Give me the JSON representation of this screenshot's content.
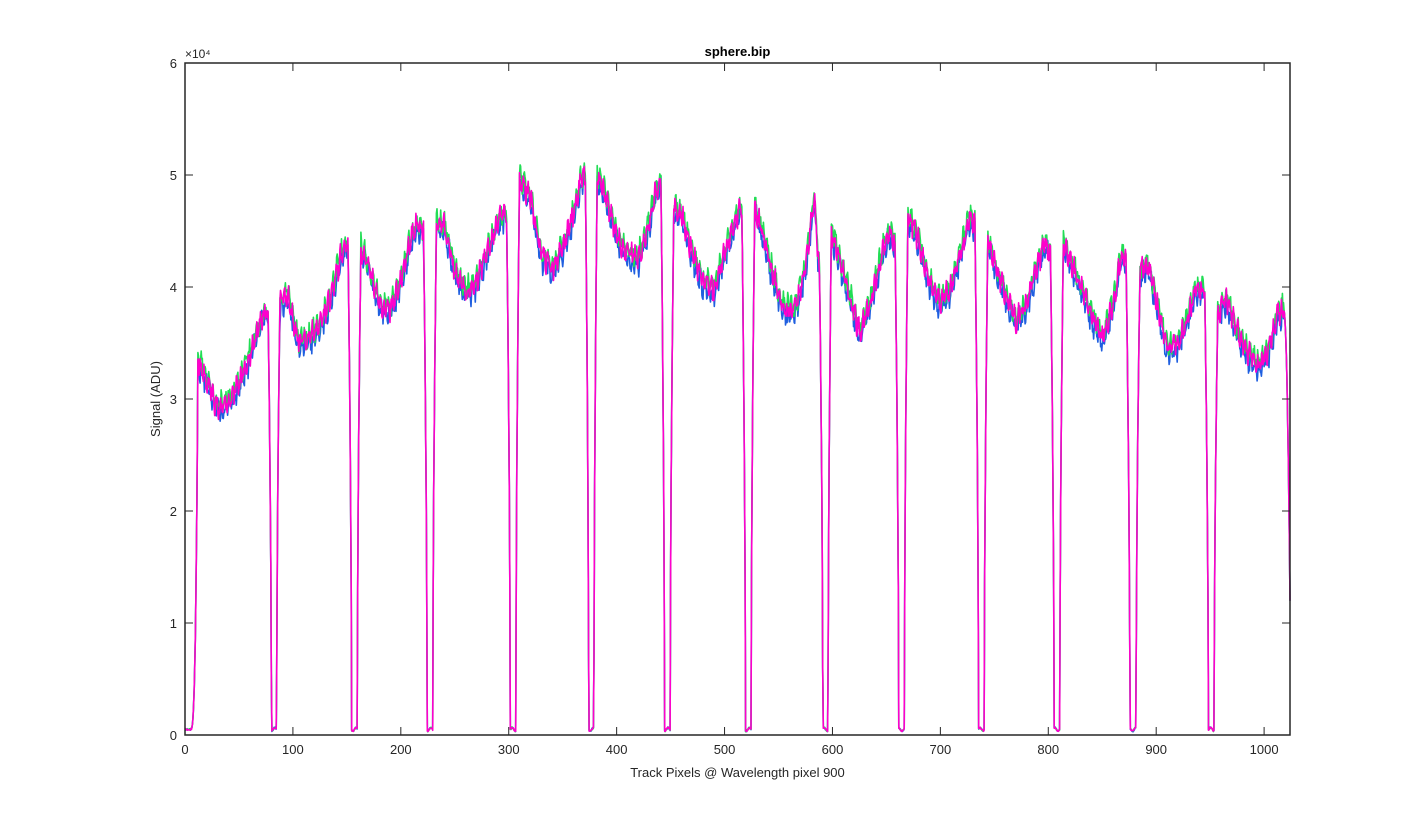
{
  "chart_data": {
    "type": "line",
    "title": "sphere.bip",
    "xlabel": "Track Pixels @ Wavelength pixel 900",
    "ylabel": "Signal (ADU)",
    "xlim": [
      0,
      1024
    ],
    "ylim": [
      0,
      60000
    ],
    "x_ticks": [
      0,
      100,
      200,
      300,
      400,
      500,
      600,
      700,
      800,
      900,
      1000
    ],
    "x_tick_labels": [
      "0",
      "100",
      "200",
      "300",
      "400",
      "500",
      "600",
      "700",
      "800",
      "900",
      "1000"
    ],
    "y_ticks": [
      0,
      10000,
      20000,
      30000,
      40000,
      50000,
      60000
    ],
    "y_tick_labels": [
      "0",
      "1",
      "2",
      "3",
      "4",
      "5",
      "6"
    ],
    "y_exponent_label": "×10⁴",
    "grid": false,
    "box": true,
    "series": [
      {
        "color": "#1f5fe0",
        "offset": -500
      },
      {
        "color": "#22dd55",
        "offset": 300
      },
      {
        "color": "#ff00cc",
        "offset": 0
      }
    ],
    "gaps_x": [
      82,
      157,
      227,
      304,
      376,
      447,
      522,
      593,
      664,
      738,
      808,
      878,
      951
    ],
    "segments": [
      {
        "x": [
          12,
          20,
          28,
          35,
          45,
          55,
          65,
          72,
          77
        ],
        "y": [
          33500,
          31800,
          29500,
          29200,
          30500,
          32500,
          35500,
          37500,
          37800
        ]
      },
      {
        "x": [
          88,
          95,
          105,
          115,
          125,
          135,
          145,
          151
        ],
        "y": [
          38500,
          39500,
          35000,
          35500,
          36500,
          39000,
          43000,
          44000
        ]
      },
      {
        "x": [
          163,
          170,
          180,
          190,
          200,
          210,
          215,
          221
        ],
        "y": [
          43500,
          42000,
          38500,
          38000,
          40500,
          44500,
          45500,
          45000
        ]
      },
      {
        "x": [
          233,
          240,
          250,
          260,
          270,
          280,
          290,
          298
        ],
        "y": [
          45500,
          45500,
          41500,
          39500,
          40500,
          43000,
          46000,
          46500
        ]
      },
      {
        "x": [
          310,
          320,
          330,
          340,
          350,
          360,
          367,
          371
        ],
        "y": [
          49500,
          48000,
          43000,
          41500,
          43500,
          46500,
          49500,
          50000
        ]
      },
      {
        "x": [
          382,
          390,
          400,
          410,
          420,
          430,
          436,
          441
        ],
        "y": [
          50000,
          48000,
          44500,
          43000,
          42500,
          45500,
          48500,
          49500
        ]
      },
      {
        "x": [
          453,
          460,
          470,
          480,
          490,
          500,
          510,
          516
        ],
        "y": [
          47000,
          46500,
          43000,
          40500,
          39800,
          43000,
          46000,
          47000
        ]
      },
      {
        "x": [
          528,
          535,
          545,
          555,
          565,
          575,
          583,
          588
        ],
        "y": [
          47000,
          45000,
          41000,
          38000,
          38000,
          41500,
          48000,
          41000
        ]
      },
      {
        "x": [
          599,
          605,
          615,
          625,
          635,
          645,
          652,
          658
        ],
        "y": [
          45000,
          43000,
          39500,
          36000,
          38500,
          42500,
          45000,
          44000
        ]
      },
      {
        "x": [
          670,
          680,
          690,
          700,
          710,
          720,
          727,
          732
        ],
        "y": [
          46500,
          44000,
          40500,
          38500,
          40000,
          43500,
          46000,
          45500
        ]
      },
      {
        "x": [
          744,
          750,
          760,
          770,
          780,
          790,
          797,
          802
        ],
        "y": [
          44500,
          42000,
          39500,
          37000,
          38500,
          42000,
          44000,
          43000
        ]
      },
      {
        "x": [
          814,
          820,
          830,
          840,
          850,
          860,
          867,
          872
        ],
        "y": [
          44000,
          42500,
          40000,
          37500,
          35500,
          38500,
          42500,
          42800
        ]
      },
      {
        "x": [
          885,
          892,
          900,
          910,
          920,
          930,
          937,
          945
        ],
        "y": [
          41500,
          42000,
          39000,
          34500,
          35000,
          37500,
          40000,
          39500
        ]
      },
      {
        "x": [
          957,
          965,
          975,
          985,
          995,
          1005,
          1012,
          1018
        ],
        "y": [
          37500,
          39000,
          36000,
          34000,
          33000,
          34500,
          37500,
          38000
        ]
      }
    ]
  }
}
